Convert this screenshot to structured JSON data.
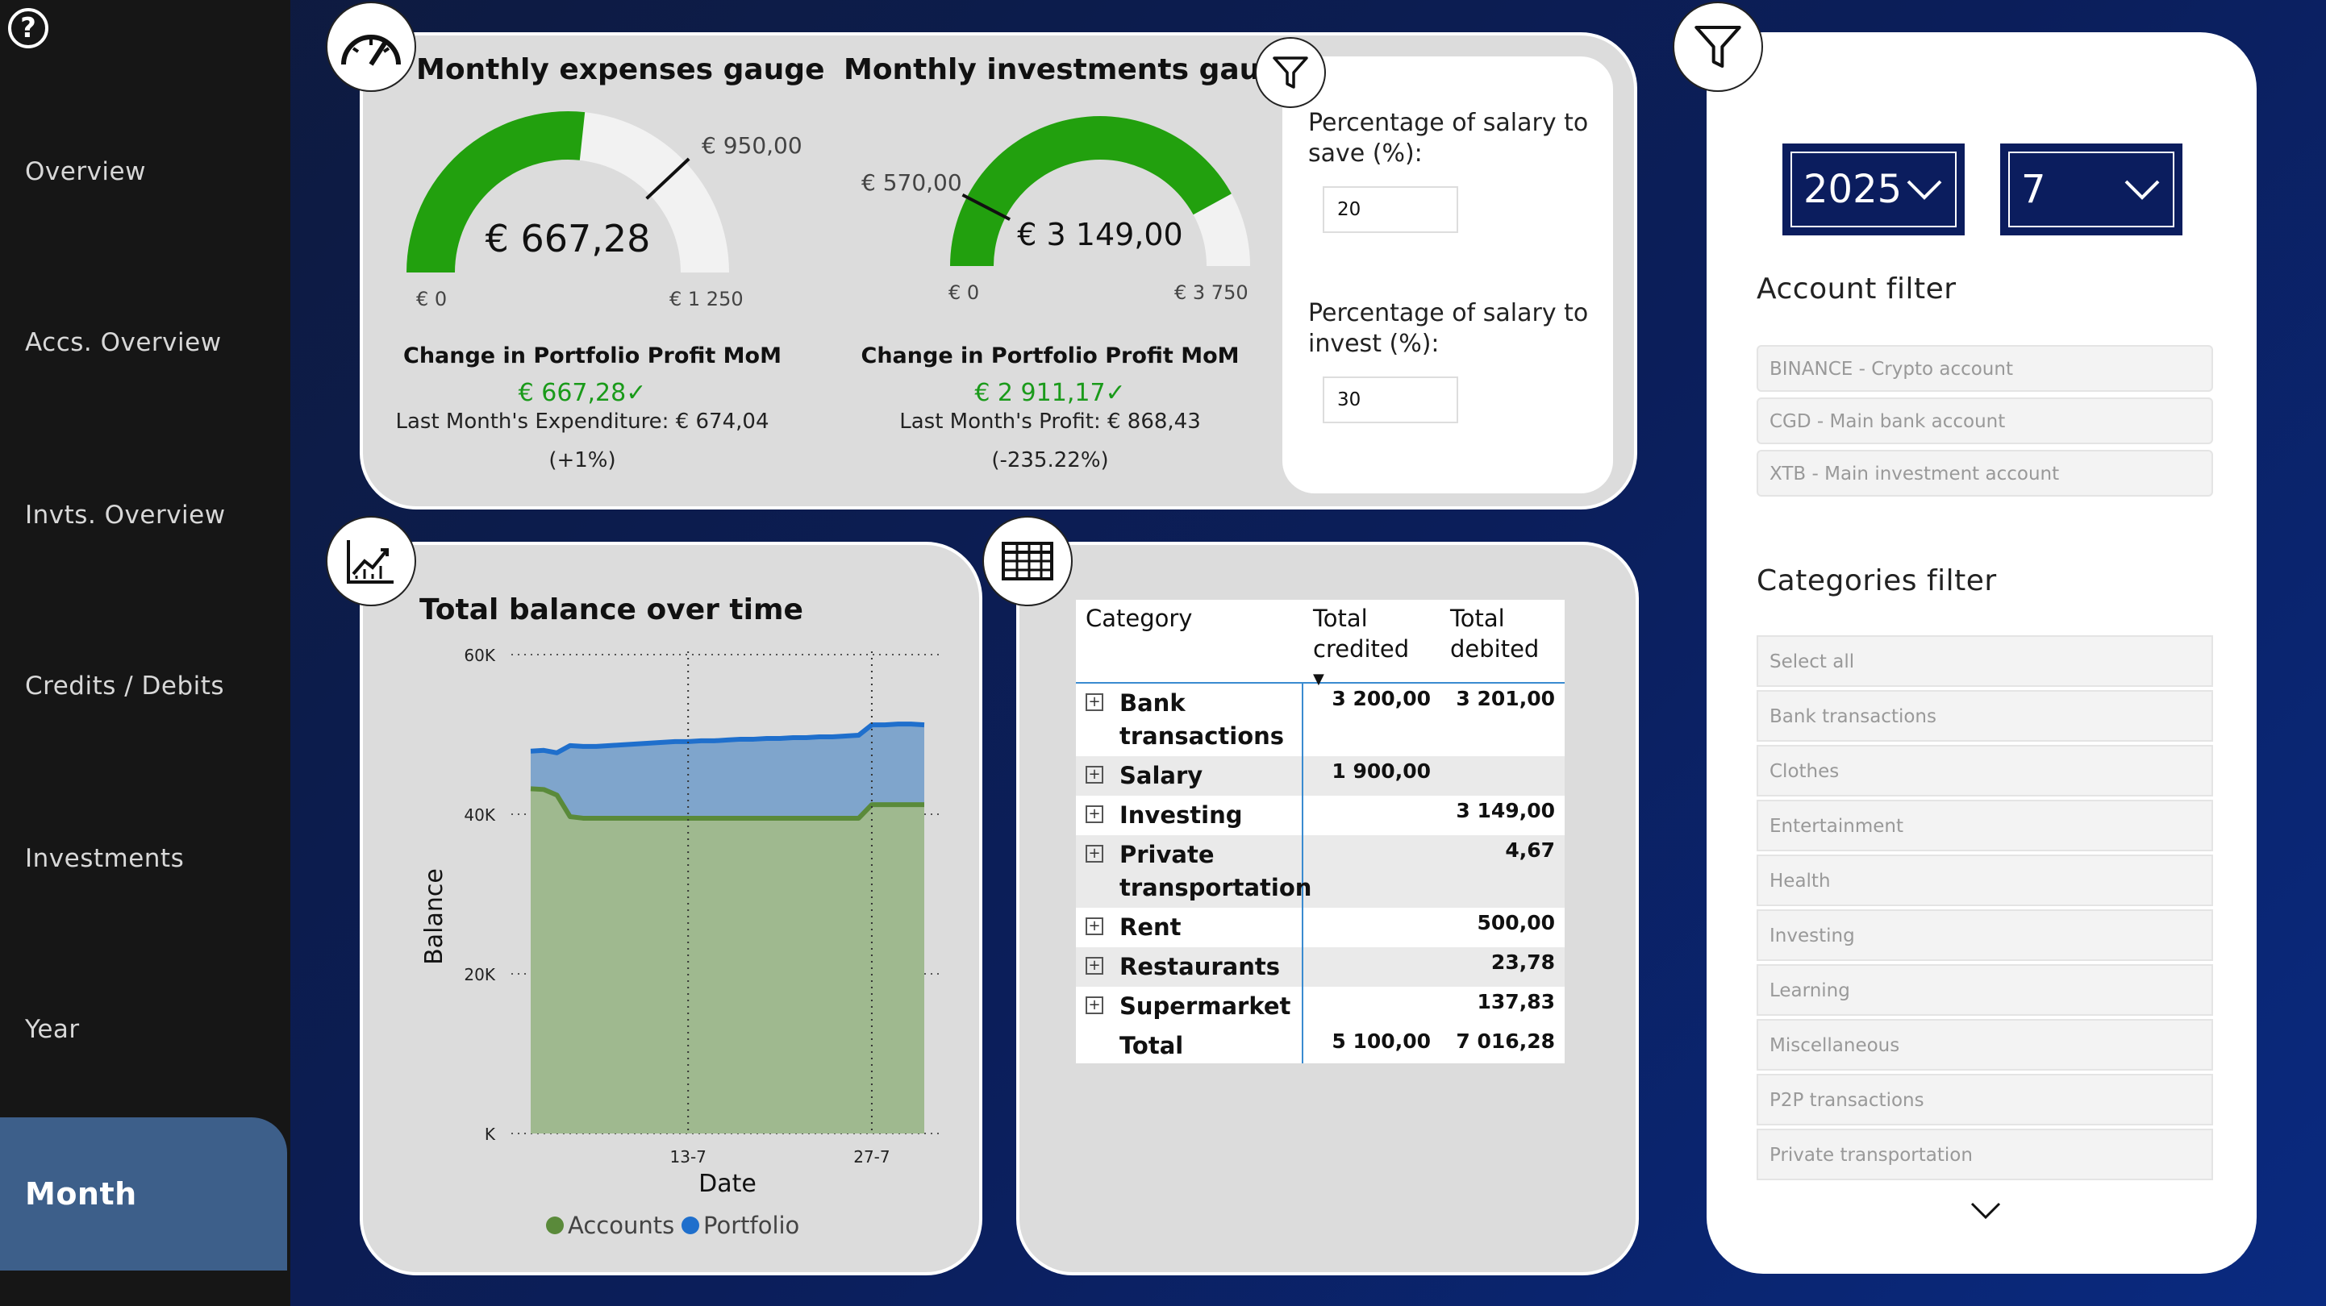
{
  "sidebar": {
    "items": [
      {
        "label": "Overview"
      },
      {
        "label": "Accs. Overview"
      },
      {
        "label": "Invts. Overview"
      },
      {
        "label": "Credits / Debits"
      },
      {
        "label": "Investments"
      },
      {
        "label": "Year"
      },
      {
        "label": "Month"
      }
    ],
    "active": "Month"
  },
  "gauges": {
    "expenses": {
      "title": "Monthly expenses gauge",
      "value_label": "€ 667,28",
      "value": 667.28,
      "min": 0,
      "max": 1250,
      "target": 950,
      "min_label": "€ 0",
      "max_label": "€ 1 250",
      "target_label": "€ 950,00",
      "kpi_title": "Change in Portfolio Profit MoM",
      "kpi_value": "€ 667,28✓",
      "kpi_sub": "Last Month's Expenditure: € 674,04",
      "kpi_pct": "(+1%)"
    },
    "investments": {
      "title": "Monthly investments gauge",
      "value_label": "€ 3 149,00",
      "value": 3149,
      "min": 0,
      "max": 3750,
      "target": 570,
      "min_label": "€ 0",
      "max_label": "€ 3 750",
      "target_label": "€ 570,00",
      "kpi_title": "Change in Portfolio Profit MoM",
      "kpi_value": "€ 2 911,17✓",
      "kpi_sub": "Last Month's Profit: € 868,43",
      "kpi_pct": "(-235.22%)"
    },
    "fill_color": "#22a00e",
    "empty_color": "#f2f2f2"
  },
  "parameters": {
    "save_label": "Percentage of salary to save (%):",
    "save_value": "20",
    "invest_label": "Percentage of salary to invest (%):",
    "invest_value": "30"
  },
  "chart_data": {
    "type": "area",
    "title": "Total balance over time",
    "xlabel": "Date",
    "ylabel": "Balance",
    "y_tick_labels": [
      "60K",
      "40K",
      "20K",
      "K"
    ],
    "ylim": [
      0,
      60000
    ],
    "x_tick_labels": [
      "13-7",
      "27-7"
    ],
    "x": [
      1,
      2,
      3,
      4,
      5,
      6,
      7,
      8,
      9,
      10,
      11,
      12,
      13,
      14,
      15,
      16,
      17,
      18,
      19,
      20,
      21,
      22,
      23,
      24,
      25,
      26,
      27,
      28,
      29,
      30,
      31
    ],
    "series": [
      {
        "name": "Accounts",
        "color": "#5a8a3a",
        "fill": "#9fb98f",
        "values": [
          43200,
          43100,
          42400,
          39700,
          39500,
          39500,
          39500,
          39500,
          39500,
          39500,
          39500,
          39500,
          39500,
          39500,
          39500,
          39500,
          39500,
          39500,
          39500,
          39500,
          39500,
          39500,
          39500,
          39500,
          39500,
          39500,
          41200,
          41200,
          41200,
          41200,
          41200
        ]
      },
      {
        "name": "Portfolio",
        "color": "#1f6fcc",
        "fill": "#7fa5cc",
        "values": [
          47900,
          48000,
          47700,
          48600,
          48500,
          48500,
          48600,
          48700,
          48800,
          48900,
          49000,
          49100,
          49100,
          49200,
          49200,
          49300,
          49400,
          49400,
          49500,
          49500,
          49600,
          49600,
          49700,
          49700,
          49800,
          49900,
          51200,
          51200,
          51300,
          51300,
          51200
        ]
      }
    ],
    "legend": [
      "Accounts",
      "Portfolio"
    ],
    "grid": true
  },
  "matrix": {
    "headers": [
      "Category",
      "Total credited",
      "Total debited"
    ],
    "rows": [
      {
        "category": "Bank transactions",
        "credited": "3 200,00",
        "debited": "3 201,00"
      },
      {
        "category": "Salary",
        "credited": "1 900,00",
        "debited": ""
      },
      {
        "category": "Investing",
        "credited": "",
        "debited": "3 149,00"
      },
      {
        "category": "Private transportation",
        "credited": "",
        "debited": "4,67"
      },
      {
        "category": "Rent",
        "credited": "",
        "debited": "500,00"
      },
      {
        "category": "Restaurants",
        "credited": "",
        "debited": "23,78"
      },
      {
        "category": "Supermarket",
        "credited": "",
        "debited": "137,83"
      }
    ],
    "total": {
      "label": "Total",
      "credited": "5 100,00",
      "debited": "7 016,28"
    }
  },
  "filters": {
    "year": "2025",
    "month": "7",
    "account_title": "Account filter",
    "accounts": [
      "BINANCE - Crypto account",
      "CGD - Main bank account",
      "XTB - Main investment account"
    ],
    "categories_title": "Categories filter",
    "categories": [
      "Select all",
      "Bank transactions",
      "Clothes",
      "Entertainment",
      "Health",
      "Investing",
      "Learning",
      "Miscellaneous",
      "P2P transactions",
      "Private transportation"
    ]
  }
}
